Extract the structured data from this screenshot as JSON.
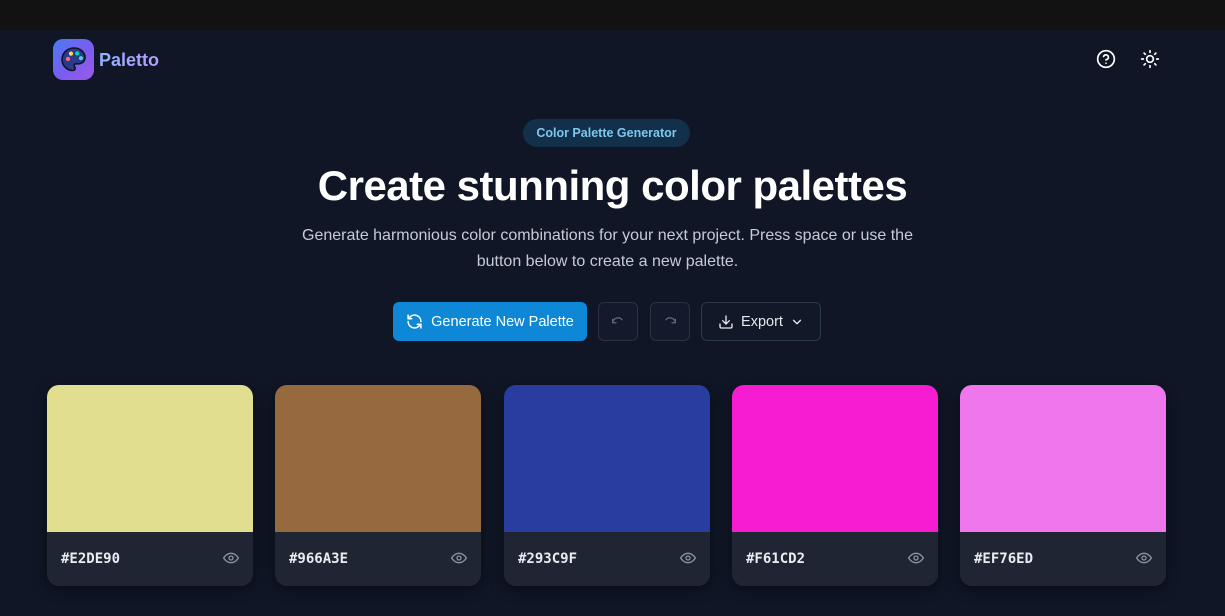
{
  "app": {
    "brand": "Paletto"
  },
  "header": {
    "icons": [
      "palette-icon",
      "help-circle-icon",
      "sun-icon"
    ]
  },
  "hero": {
    "badge": "Color Palette Generator",
    "title": "Create stunning color palettes",
    "subtitle": "Generate harmonious color combinations for your next project. Press space or use the button below to create a new palette."
  },
  "actions": {
    "generate_label": "Generate New Palette",
    "export_label": "Export"
  },
  "palette": [
    {
      "hex": "#E2DE90",
      "color": "#E2DE90"
    },
    {
      "hex": "#966A3E",
      "color": "#966A3E"
    },
    {
      "hex": "#293C9F",
      "color": "#293C9F"
    },
    {
      "hex": "#F61CD2",
      "color": "#F61CD2"
    },
    {
      "hex": "#EF76ED",
      "color": "#EF76ED"
    }
  ],
  "colors": {
    "background": "#101626",
    "accent": "#0D87D6",
    "card": "#1F2533"
  }
}
